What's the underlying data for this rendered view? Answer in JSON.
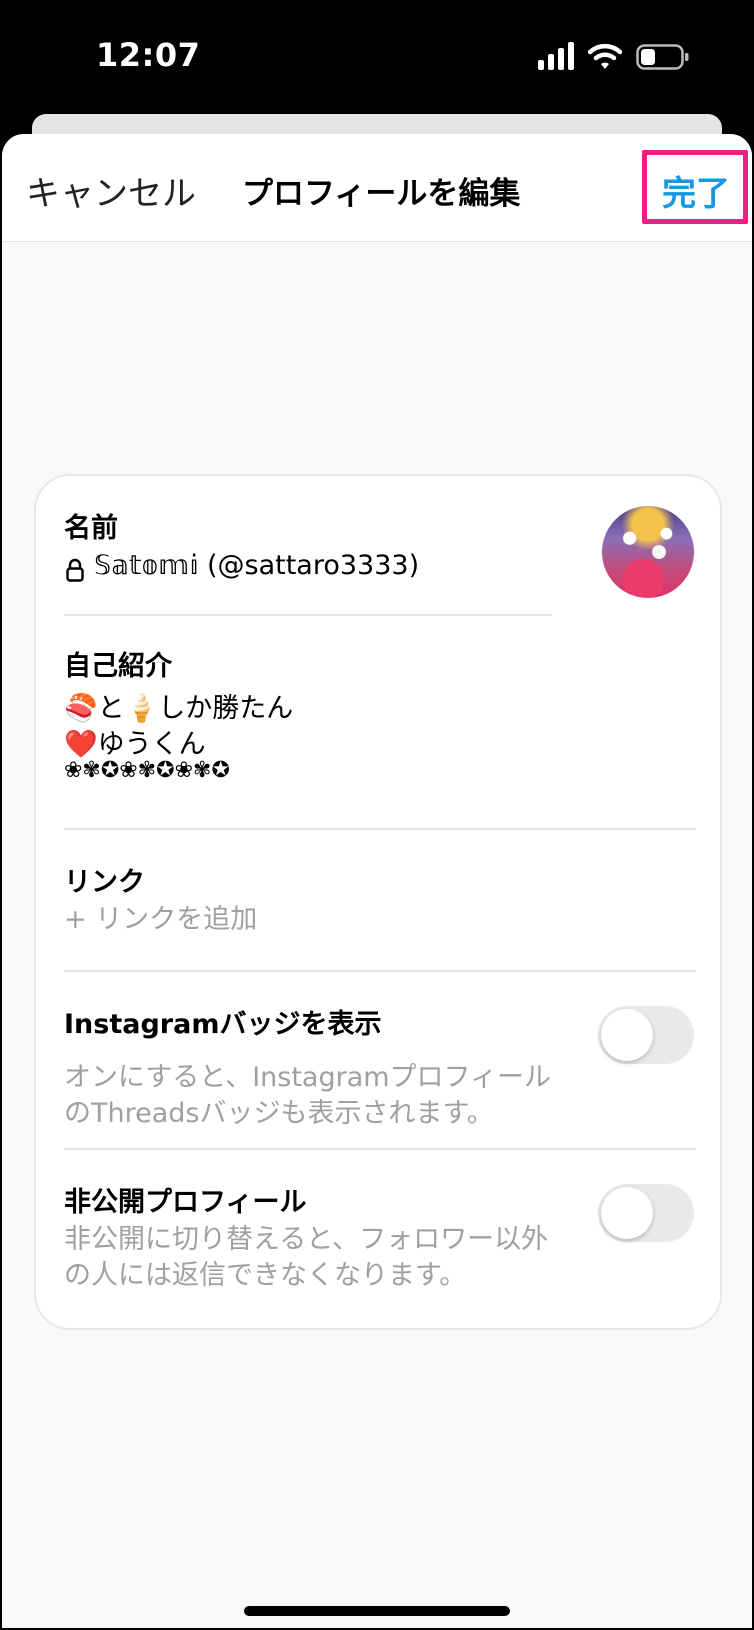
{
  "status_bar": {
    "time": "12:07"
  },
  "nav": {
    "cancel_label": "キャンセル",
    "title": "プロフィールを編集",
    "done_label": "完了",
    "done_color": "#1596e6",
    "highlight_color": "#ef1e82"
  },
  "profile": {
    "name_label": "名前",
    "name_value": "𝕊𝕒𝕥𝕠𝕞𝕚 (@sattaro3333)",
    "bio_label": "自己紹介",
    "bio_line1": "🍣と🍦しか勝たん",
    "bio_line2": "❤️ゆうくん",
    "bio_line3": "❀✾✪❀✾✪❀✾✪",
    "link_label": "リンク",
    "link_placeholder": "+ リンクを追加",
    "instagram_badge_label": "Instagramバッジを表示",
    "instagram_badge_desc_line1": "オンにすると、Instagramプロフィール",
    "instagram_badge_desc_line2": "のThreadsバッジも表示されます。",
    "instagram_badge_on": false,
    "private_label": "非公開プロフィール",
    "private_desc_line1": "非公開に切り替えると、フォロワー以外",
    "private_desc_line2": "の人には返信できなくなります。",
    "private_on": false
  },
  "icons": {
    "lock": "lock-icon",
    "signal": "signal-icon",
    "wifi": "wifi-icon",
    "battery": "battery-icon"
  }
}
